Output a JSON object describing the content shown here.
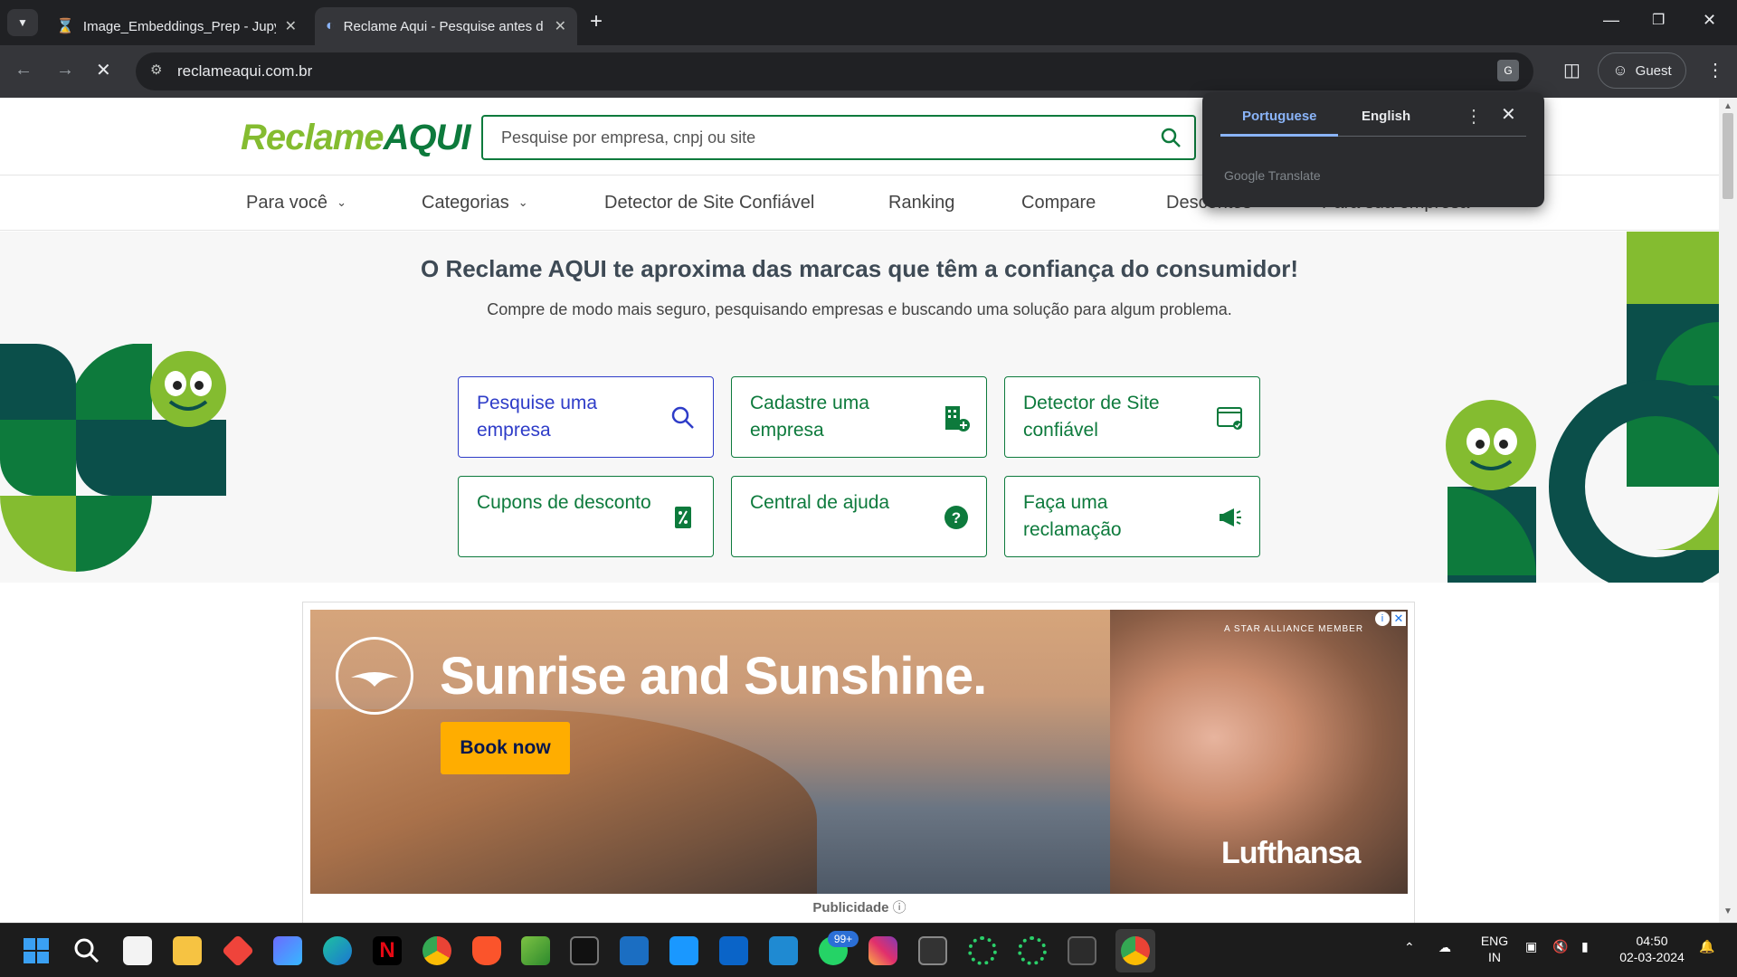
{
  "browser": {
    "tabs": [
      {
        "title": "Image_Embeddings_Prep - Jupy",
        "icon": "hourglass-icon"
      },
      {
        "title": "Reclame Aqui - Pesquise antes d",
        "icon": "loading-icon"
      }
    ],
    "url": "reclameaqui.com.br",
    "guest_label": "Guest"
  },
  "site": {
    "logo_part1": "Reclame",
    "logo_part2": "AQUI",
    "search_placeholder": "Pesquise por empresa, cnpj ou site",
    "nav": [
      {
        "label": "Para você",
        "dropdown": true
      },
      {
        "label": "Categorias",
        "dropdown": true
      },
      {
        "label": "Detector de Site Confiável",
        "dropdown": false
      },
      {
        "label": "Ranking",
        "dropdown": false
      },
      {
        "label": "Compare",
        "dropdown": false
      },
      {
        "label": "Descontos",
        "dropdown": false
      },
      {
        "label": "Para sua empresa",
        "dropdown": false
      }
    ],
    "hero_title": "O Reclame AQUI te aproxima das marcas que têm a confiança do consumidor!",
    "hero_subtitle": "Compre de modo mais seguro, pesquisando empresas e buscando uma solução para algum problema.",
    "cards": [
      {
        "label": "Pesquise uma empresa",
        "icon": "search-icon"
      },
      {
        "label": "Cadastre uma empresa",
        "icon": "building-add-icon"
      },
      {
        "label": "Detector de Site confiável",
        "icon": "www-check-icon"
      },
      {
        "label": "Cupons de desconto",
        "icon": "coupon-icon"
      },
      {
        "label": "Central de ajuda",
        "icon": "help-icon"
      },
      {
        "label": "Faça uma reclamação",
        "icon": "megaphone-icon"
      }
    ],
    "colors": {
      "green": "#0d7a3c",
      "lime": "#84bc30",
      "blue": "#2e3cc8"
    }
  },
  "ad": {
    "headline": "Sunrise and Sunshine.",
    "cta": "Book now",
    "brand": "Lufthansa",
    "tag": "A STAR ALLIANCE MEMBER",
    "label": "Publicidade"
  },
  "translate_popup": {
    "tab_source": "Portuguese",
    "tab_target": "English",
    "brand": "Google Translate"
  },
  "taskbar": {
    "whatsapp_badge": "99+",
    "lang_line1": "ENG",
    "lang_line2": "IN",
    "time": "04:50",
    "date": "02-03-2024"
  }
}
